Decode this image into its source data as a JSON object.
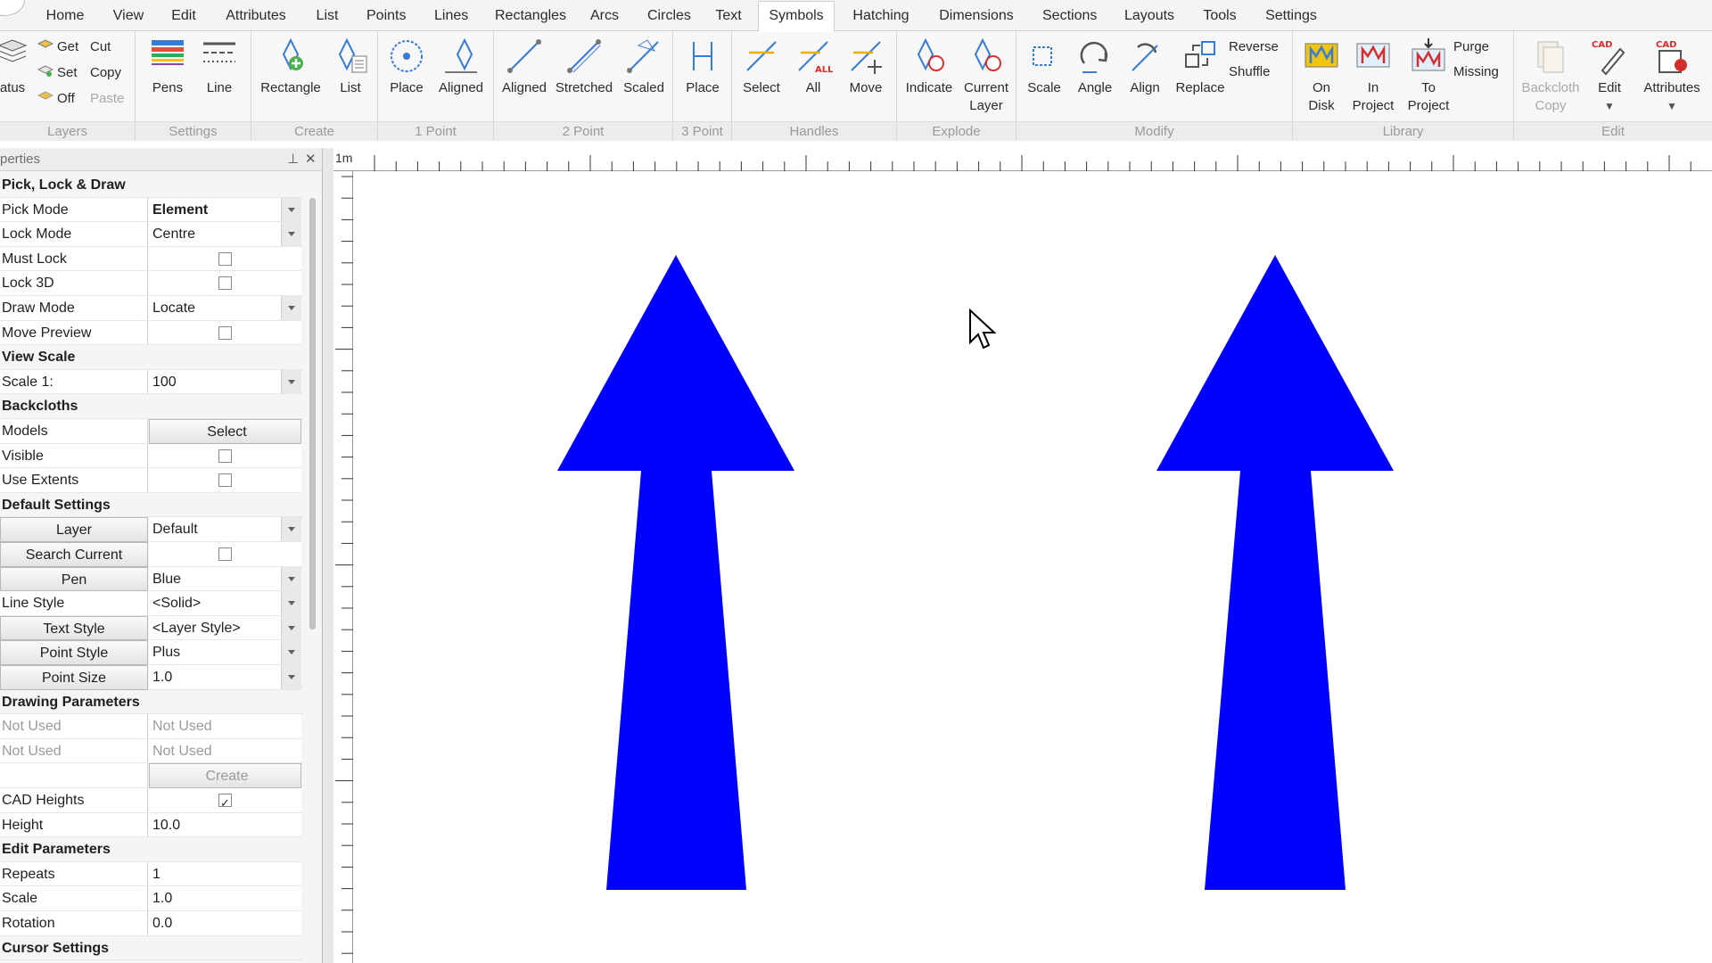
{
  "tabs": [
    "Home",
    "View",
    "Edit",
    "Attributes",
    "List",
    "Points",
    "Lines",
    "Rectangles",
    "Arcs",
    "Circles",
    "Text",
    "Symbols",
    "Hatching",
    "Dimensions",
    "Sections",
    "Layouts",
    "Tools",
    "Settings"
  ],
  "active_tab": "Symbols",
  "ribbon": {
    "layers": {
      "label": "Layers",
      "status": "atus",
      "get": "Get",
      "set": "Set",
      "off": "Off",
      "cut": "Cut",
      "copy": "Copy",
      "paste": "Paste"
    },
    "settings": {
      "label": "Settings",
      "pens": "Pens",
      "line": "Line"
    },
    "create": {
      "label": "Create",
      "rectangle": "Rectangle",
      "list": "List"
    },
    "one_point": {
      "label": "1 Point",
      "place": "Place",
      "aligned": "Aligned"
    },
    "two_point": {
      "label": "2 Point",
      "aligned": "Aligned",
      "stretched": "Stretched",
      "scaled": "Scaled"
    },
    "three_point": {
      "label": "3 Point",
      "place": "Place"
    },
    "handles": {
      "label": "Handles",
      "select": "Select",
      "all": "All",
      "move": "Move"
    },
    "explode": {
      "label": "Explode",
      "indicate": "Indicate",
      "current_layer_1": "Current",
      "current_layer_2": "Layer"
    },
    "modify": {
      "label": "Modify",
      "scale": "Scale",
      "angle": "Angle",
      "align": "Align",
      "replace": "Replace",
      "reverse": "Reverse",
      "shuffle": "Shuffle"
    },
    "library": {
      "label": "Library",
      "on_disk_1": "On",
      "on_disk_2": "Disk",
      "in_project_1": "In",
      "in_project_2": "Project",
      "to_project_1": "To",
      "to_project_2": "Project",
      "purge": "Purge",
      "missing": "Missing"
    },
    "edit": {
      "label": "Edit",
      "backcloth_1": "Backcloth",
      "backcloth_2": "Copy",
      "edit": "Edit",
      "attributes": "Attributes",
      "cad_tag": "CAD"
    }
  },
  "properties": {
    "title": "perties",
    "rows": [
      {
        "type": "section",
        "label": "Pick, Lock & Draw"
      },
      {
        "label": "Pick Mode",
        "value": "Element",
        "kind": "dropdown",
        "bold": true
      },
      {
        "label": "Lock Mode",
        "value": "Centre",
        "kind": "dropdown"
      },
      {
        "label": "Must Lock",
        "kind": "checkbox",
        "checked": false
      },
      {
        "label": "Lock 3D",
        "kind": "checkbox",
        "checked": false
      },
      {
        "label": "Draw Mode",
        "value": "Locate",
        "kind": "dropdown"
      },
      {
        "label": "Move Preview",
        "kind": "checkbox",
        "checked": false
      },
      {
        "type": "section",
        "label": "View Scale"
      },
      {
        "label": "Scale 1:",
        "value": "100",
        "kind": "dropdown"
      },
      {
        "type": "section",
        "label": "Backcloths"
      },
      {
        "label": "Models",
        "value": "Select",
        "kind": "button"
      },
      {
        "label": "Visible",
        "kind": "checkbox",
        "checked": false
      },
      {
        "label": "Use Extents",
        "kind": "checkbox",
        "checked": false
      },
      {
        "type": "section",
        "label": "Default Settings"
      },
      {
        "label": "Layer",
        "value": "Default",
        "kind": "dropdown",
        "label_button": true
      },
      {
        "label": "Search Current",
        "kind": "checkbox",
        "checked": false,
        "label_button": true
      },
      {
        "label": "Pen",
        "value": "Blue",
        "kind": "dropdown",
        "label_button": true
      },
      {
        "label": "Line Style",
        "value": "<Solid>",
        "kind": "dropdown"
      },
      {
        "label": "Text Style",
        "value": "<Layer Style>",
        "kind": "dropdown",
        "label_button": true
      },
      {
        "label": "Point Style",
        "value": "Plus",
        "kind": "dropdown",
        "label_button": true
      },
      {
        "label": "Point Size",
        "value": "1.0",
        "kind": "dropdown",
        "label_button": true
      },
      {
        "type": "section",
        "label": "Drawing Parameters"
      },
      {
        "label": "Not Used",
        "value": "Not Used",
        "kind": "text",
        "dim": true
      },
      {
        "label": "Not Used",
        "value": "Not Used",
        "kind": "text",
        "dim": true
      },
      {
        "label": "",
        "value": "Create",
        "kind": "button",
        "dim": true
      },
      {
        "label": "CAD Heights",
        "kind": "checkbox",
        "checked": true
      },
      {
        "label": "Height",
        "value": "10.0",
        "kind": "text"
      },
      {
        "type": "section",
        "label": "Edit Parameters"
      },
      {
        "label": "Repeats",
        "value": "1",
        "kind": "text"
      },
      {
        "label": "Scale",
        "value": "1.0",
        "kind": "text"
      },
      {
        "label": "Rotation",
        "value": "0.0",
        "kind": "text"
      },
      {
        "type": "section",
        "label": "Cursor Settings"
      }
    ]
  },
  "ruler": {
    "unit_label": "1m"
  },
  "canvas": {
    "symbol_color": "#0000ff",
    "symbols": [
      "arrow-symbol",
      "arrow-symbol"
    ]
  },
  "colors": {
    "accent": "#0000ff",
    "ribbon_bg": "#f7f7f7"
  }
}
